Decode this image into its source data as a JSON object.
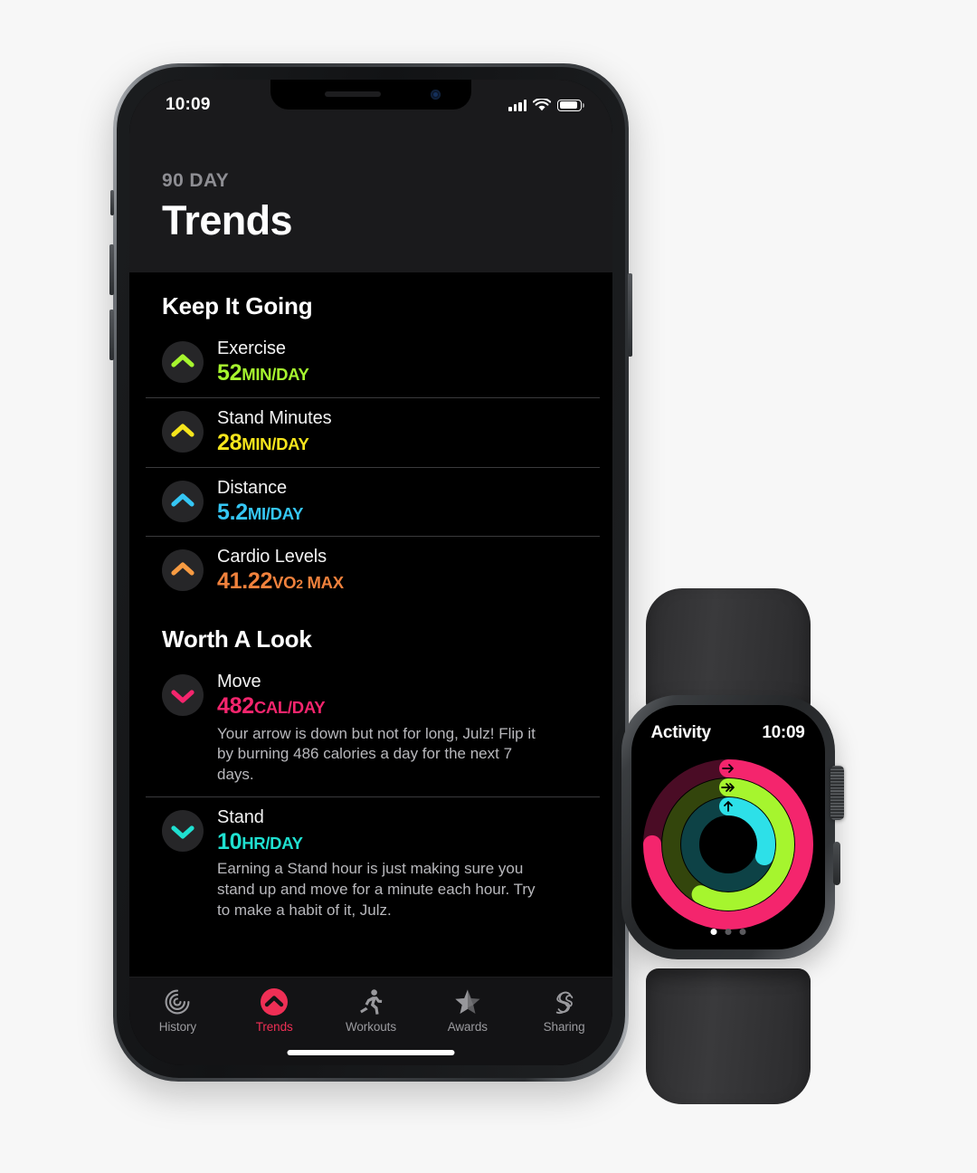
{
  "colors": {
    "page_background": "#f7f7f7",
    "move": "#f4256d",
    "move_dim": "#ff2d55",
    "exercise": "#a6f52e",
    "exercise_green": "#92e82a",
    "stand": "#1fe0d0",
    "stand_blue": "#35c6f4",
    "distance": "#35c6f4",
    "cardio": "#f79b42",
    "stand_minutes": "#f5e51c",
    "accent_tab": "#ef2f55"
  },
  "phone": {
    "status_bar": {
      "time": "10:09",
      "signal_icon": "cellular-signal-icon",
      "wifi_icon": "wifi-icon",
      "battery_icon": "battery-icon"
    },
    "header": {
      "eyebrow": "90 DAY",
      "title": "Trends"
    },
    "sections": [
      {
        "title": "Keep It Going",
        "rows": [
          {
            "icon": "chevron-up-icon",
            "icon_color": "#a6f52e",
            "label": "Exercise",
            "value": "52",
            "unit": "MIN/DAY",
            "value_color": "#a6f52e",
            "description": ""
          },
          {
            "icon": "chevron-up-icon",
            "icon_color": "#f5e51c",
            "label": "Stand Minutes",
            "value": "28",
            "unit": "MIN/DAY",
            "value_color": "#f5e51c",
            "description": ""
          },
          {
            "icon": "chevron-up-icon",
            "icon_color": "#35c6f4",
            "label": "Distance",
            "value": "5.2",
            "unit": "MI/DAY",
            "value_color": "#35c6f4",
            "description": ""
          },
          {
            "icon": "chevron-up-icon",
            "icon_color": "#f79b42",
            "label": "Cardio Levels",
            "value": "41.22",
            "unit": "VO",
            "unit_sub": "2",
            "unit_tail": " MAX",
            "value_color": "#f0813c",
            "description": ""
          }
        ]
      },
      {
        "title": "Worth A Look",
        "rows": [
          {
            "icon": "chevron-down-icon",
            "icon_color": "#f4256d",
            "label": "Move",
            "value": "482",
            "unit": "CAL/DAY",
            "value_color": "#f4256d",
            "description": "Your arrow is down but not for long, Julz! Flip it by burning 486 calories a day for the next 7 days."
          },
          {
            "icon": "chevron-down-icon",
            "icon_color": "#1fe0d0",
            "label": "Stand",
            "value": "10",
            "unit": "HR/DAY",
            "value_color": "#1fe0d0",
            "description": "Earning a Stand hour is just making sure you stand up and move for a minute each hour. Try to make a habit of it, Julz."
          }
        ]
      }
    ],
    "tabs": [
      {
        "label": "History",
        "icon": "history-spiral-icon",
        "active": false
      },
      {
        "label": "Trends",
        "icon": "trends-chevron-icon",
        "active": true
      },
      {
        "label": "Workouts",
        "icon": "workouts-runner-icon",
        "active": false
      },
      {
        "label": "Awards",
        "icon": "awards-star-icon",
        "active": false
      },
      {
        "label": "Sharing",
        "icon": "sharing-s-icon",
        "active": false
      }
    ]
  },
  "watch": {
    "app_name": "Activity",
    "time": "10:09",
    "page_dots": {
      "count": 3,
      "active_index": 0
    },
    "rings": [
      {
        "name": "Move",
        "color": "#f4256d",
        "track_color": "#4a0c25",
        "percent": 75,
        "arrow_icon": "arrow-right-icon",
        "radius": 84
      },
      {
        "name": "Exercise",
        "color": "#a6f52e",
        "track_color": "#33450c",
        "percent": 58,
        "arrow_icon": "double-arrow-right-icon",
        "radius": 63
      },
      {
        "name": "Stand",
        "color": "#2de0e8",
        "track_color": "#0d4246",
        "percent": 30,
        "arrow_icon": "arrow-up-icon",
        "radius": 42
      }
    ]
  },
  "chart_data": {
    "type": "pie",
    "title": "Activity Rings",
    "series": [
      {
        "name": "Move",
        "value": 75,
        "unit": "%",
        "color": "#f4256d"
      },
      {
        "name": "Exercise",
        "value": 58,
        "unit": "%",
        "color": "#a6f52e"
      },
      {
        "name": "Stand",
        "value": 30,
        "unit": "%",
        "color": "#2de0e8"
      }
    ],
    "legend": "none",
    "grid": false
  }
}
